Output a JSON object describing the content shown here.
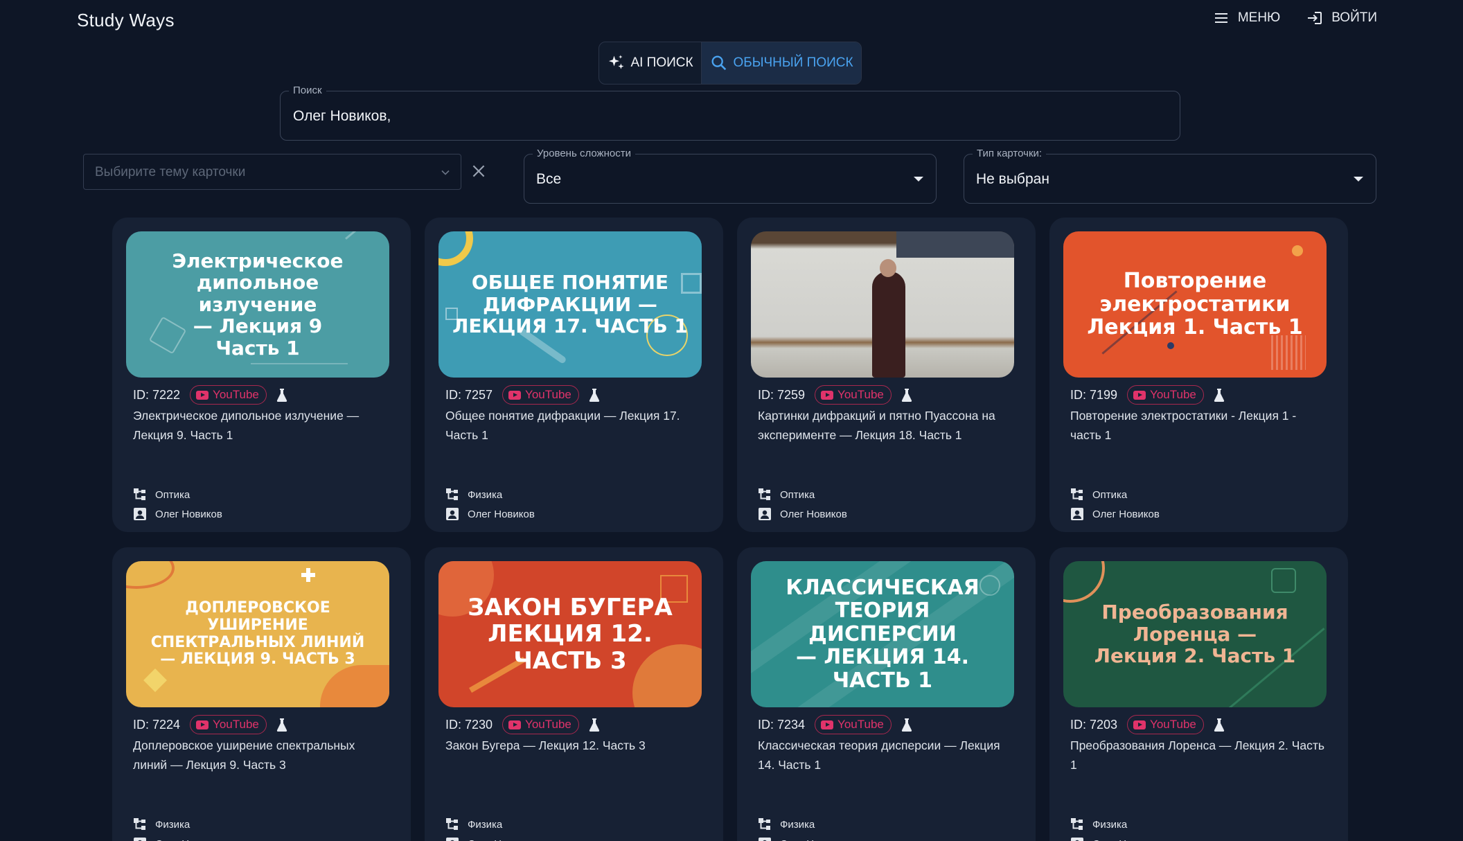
{
  "header": {
    "app_title": "Study Ways",
    "menu_label": "МЕНЮ",
    "login_label": "ВОЙТИ"
  },
  "search_mode": {
    "ai_label": "AI ПОИСК",
    "regular_label": "ОБЫЧНЫЙ ПОИСК",
    "active": "regular"
  },
  "search": {
    "label": "Поиск",
    "value": "Олег Новиков,"
  },
  "filters": {
    "topic_placeholder": "Выбирите тему карточки",
    "difficulty_label": "Уровень сложности",
    "difficulty_value": "Все",
    "card_type_label": "Тип карточки:",
    "card_type_value": "Не выбран"
  },
  "colors": {
    "background": "#0e1626",
    "card_bg": "#172134",
    "accent_blue": "#4aa3f0",
    "youtube_pink": "#e0336a"
  },
  "cards": [
    {
      "id": "ID: 7222",
      "source": "YouTube",
      "title": "Электрическое дипольное излучение — Лекция 9. Часть 1",
      "thumb_text": "Электрическое\nдипольное излучение\n— Лекция 9\nЧасть 1",
      "thumb_bg": "#4c9da4",
      "thumb_color": "#ffffff",
      "topic": "Оптика",
      "author": "Олег Новиков"
    },
    {
      "id": "ID: 7257",
      "source": "YouTube",
      "title": "Общее понятие дифракции — Лекция 17. Часть 1",
      "thumb_text": "ОБЩЕЕ ПОНЯТИЕ\nДИФРАКЦИИ —\nЛЕКЦИЯ 17. ЧАСТЬ 1",
      "thumb_bg": "#3e9cb4",
      "thumb_color": "#ffffff",
      "topic": "Физика",
      "author": "Олег Новиков"
    },
    {
      "id": "ID: 7259",
      "source": "YouTube",
      "title": "Картинки дифракций и пятно Пуассона на эксперименте — Лекция 18. Часть 1",
      "thumb_text": "",
      "thumb_bg": "#8a7a66",
      "thumb_color": "#ffffff",
      "topic": "Оптика",
      "author": "Олег Новиков"
    },
    {
      "id": "ID: 7199",
      "source": "YouTube",
      "title": "Повторение электростатики - Лекция 1 - часть 1",
      "thumb_text": "Повторение\nэлектростатики\nЛекция 1. Часть 1",
      "thumb_bg": "#e2542c",
      "thumb_color": "#ffffff",
      "topic": "Оптика",
      "author": "Олег Новиков"
    },
    {
      "id": "ID: 7224",
      "source": "YouTube",
      "title": "Доплеровское уширение спектральных линий — Лекция 9. Часть 3",
      "thumb_text": "ДОПЛЕРОВСКОЕ УШИРЕНИЕ\nСПЕКТРАЛЬНЫХ ЛИНИЙ\n— ЛЕКЦИЯ 9. ЧАСТЬ 3",
      "thumb_bg": "#e8b44e",
      "thumb_color": "#ffffff",
      "topic": "Физика",
      "author": "Олег Новиков"
    },
    {
      "id": "ID: 7230",
      "source": "YouTube",
      "title": "Закон Бугера — Лекция 12. Часть 3",
      "thumb_text": "ЗАКОН БУГЕРА\nЛЕКЦИЯ 12. ЧАСТЬ 3",
      "thumb_bg": "#d1452a",
      "thumb_color": "#ffffff",
      "topic": "Физика",
      "author": "Олег Новиков"
    },
    {
      "id": "ID: 7234",
      "source": "YouTube",
      "title": "Классическая теория дисперсии — Лекция 14. Часть 1",
      "thumb_text": "КЛАССИЧЕСКАЯ\nТЕОРИЯ ДИСПЕРСИИ\n— ЛЕКЦИЯ 14.  ЧАСТЬ 1",
      "thumb_bg": "#2f8e8c",
      "thumb_color": "#ffffff",
      "topic": "Физика",
      "author": "Олег Новиков"
    },
    {
      "id": "ID: 7203",
      "source": "YouTube",
      "title": "Преобразования Лоренса — Лекция 2. Часть 1",
      "thumb_text": "Преобразования\nЛоренца —\nЛекция 2. Часть 1",
      "thumb_bg": "#1f5741",
      "thumb_color": "#f0b593",
      "topic": "Физика",
      "author": "Олег Новиков"
    }
  ]
}
